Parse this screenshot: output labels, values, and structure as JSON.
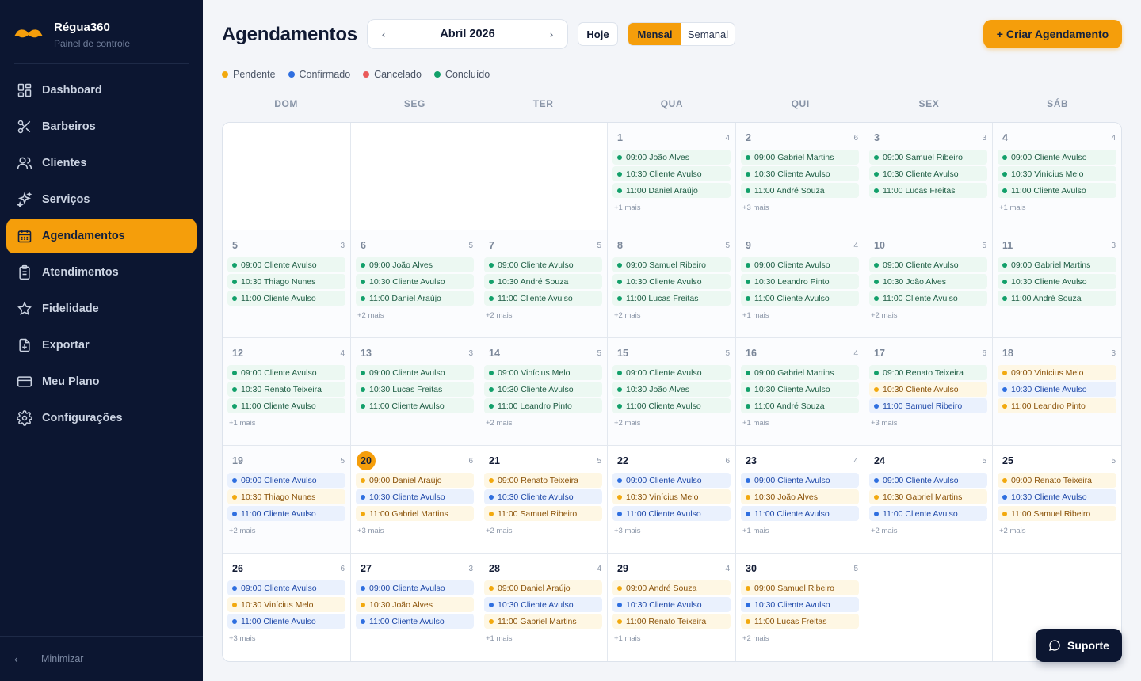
{
  "brand": {
    "name": "Régua360",
    "subtitle": "Painel de controle"
  },
  "nav": [
    {
      "label": "Dashboard",
      "icon": "dashboard-icon",
      "active": false
    },
    {
      "label": "Barbeiros",
      "icon": "scissors-icon",
      "active": false
    },
    {
      "label": "Clientes",
      "icon": "users-icon",
      "active": false
    },
    {
      "label": "Serviços",
      "icon": "sparkles-icon",
      "active": false
    },
    {
      "label": "Agendamentos",
      "icon": "calendar-icon",
      "active": true
    },
    {
      "label": "Atendimentos",
      "icon": "clipboard-icon",
      "active": false
    },
    {
      "label": "Fidelidade",
      "icon": "star-icon",
      "active": false
    },
    {
      "label": "Exportar",
      "icon": "file-download-icon",
      "active": false
    },
    {
      "label": "Meu Plano",
      "icon": "credit-card-icon",
      "active": false
    },
    {
      "label": "Configurações",
      "icon": "gear-icon",
      "active": false
    }
  ],
  "sidebar_footer": {
    "label": "Minimizar"
  },
  "header": {
    "title": "Agendamentos",
    "month_label": "Abril 2026",
    "prev": "‹",
    "next": "›",
    "today_label": "Hoje",
    "view_options": [
      {
        "label": "Mensal",
        "active": true
      },
      {
        "label": "Semanal",
        "active": false
      }
    ],
    "create_label": "+ Criar Agendamento"
  },
  "legend": [
    {
      "label": "Pendente",
      "color": "#f2a90e"
    },
    {
      "label": "Confirmado",
      "color": "#2f6fe0"
    },
    {
      "label": "Cancelado",
      "color": "#ea5a5a"
    },
    {
      "label": "Concluído",
      "color": "#12a06a"
    }
  ],
  "weekdays": [
    "DOM",
    "SEG",
    "TER",
    "QUA",
    "QUI",
    "SEX",
    "SÁB"
  ],
  "calendar": {
    "leading_empty": 3,
    "trailing_empty": 2,
    "today": 20,
    "days": [
      {
        "day": "1",
        "count": "4",
        "events": [
          [
            "09:00 João Alves",
            "done"
          ],
          [
            "10:30 Cliente Avulso",
            "done"
          ],
          [
            "11:00 Daniel Araújo",
            "done"
          ]
        ],
        "more": "+1 mais"
      },
      {
        "day": "2",
        "count": "6",
        "events": [
          [
            "09:00 Gabriel Martins",
            "done"
          ],
          [
            "10:30 Cliente Avulso",
            "done"
          ],
          [
            "11:00 André Souza",
            "done"
          ]
        ],
        "more": "+3 mais"
      },
      {
        "day": "3",
        "count": "3",
        "events": [
          [
            "09:00 Samuel Ribeiro",
            "done"
          ],
          [
            "10:30 Cliente Avulso",
            "done"
          ],
          [
            "11:00 Lucas Freitas",
            "done"
          ]
        ],
        "more": ""
      },
      {
        "day": "4",
        "count": "4",
        "events": [
          [
            "09:00 Cliente Avulso",
            "done"
          ],
          [
            "10:30 Vinícius Melo",
            "done"
          ],
          [
            "11:00 Cliente Avulso",
            "done"
          ]
        ],
        "more": "+1 mais"
      },
      {
        "day": "5",
        "count": "3",
        "events": [
          [
            "09:00 Cliente Avulso",
            "done"
          ],
          [
            "10:30 Thiago Nunes",
            "done"
          ],
          [
            "11:00 Cliente Avulso",
            "done"
          ]
        ],
        "more": ""
      },
      {
        "day": "6",
        "count": "5",
        "events": [
          [
            "09:00 João Alves",
            "done"
          ],
          [
            "10:30 Cliente Avulso",
            "done"
          ],
          [
            "11:00 Daniel Araújo",
            "done"
          ]
        ],
        "more": "+2 mais"
      },
      {
        "day": "7",
        "count": "5",
        "events": [
          [
            "09:00 Cliente Avulso",
            "done"
          ],
          [
            "10:30 André Souza",
            "done"
          ],
          [
            "11:00 Cliente Avulso",
            "done"
          ]
        ],
        "more": "+2 mais"
      },
      {
        "day": "8",
        "count": "5",
        "events": [
          [
            "09:00 Samuel Ribeiro",
            "done"
          ],
          [
            "10:30 Cliente Avulso",
            "done"
          ],
          [
            "11:00 Lucas Freitas",
            "done"
          ]
        ],
        "more": "+2 mais"
      },
      {
        "day": "9",
        "count": "4",
        "events": [
          [
            "09:00 Cliente Avulso",
            "done"
          ],
          [
            "10:30 Leandro Pinto",
            "done"
          ],
          [
            "11:00 Cliente Avulso",
            "done"
          ]
        ],
        "more": "+1 mais"
      },
      {
        "day": "10",
        "count": "5",
        "events": [
          [
            "09:00 Cliente Avulso",
            "done"
          ],
          [
            "10:30 João Alves",
            "done"
          ],
          [
            "11:00 Cliente Avulso",
            "done"
          ]
        ],
        "more": "+2 mais"
      },
      {
        "day": "11",
        "count": "3",
        "events": [
          [
            "09:00 Gabriel Martins",
            "done"
          ],
          [
            "10:30 Cliente Avulso",
            "done"
          ],
          [
            "11:00 André Souza",
            "done"
          ]
        ],
        "more": ""
      },
      {
        "day": "12",
        "count": "4",
        "events": [
          [
            "09:00 Cliente Avulso",
            "done"
          ],
          [
            "10:30 Renato Teixeira",
            "done"
          ],
          [
            "11:00 Cliente Avulso",
            "done"
          ]
        ],
        "more": "+1 mais"
      },
      {
        "day": "13",
        "count": "3",
        "events": [
          [
            "09:00 Cliente Avulso",
            "done"
          ],
          [
            "10:30 Lucas Freitas",
            "done"
          ],
          [
            "11:00 Cliente Avulso",
            "done"
          ]
        ],
        "more": ""
      },
      {
        "day": "14",
        "count": "5",
        "events": [
          [
            "09:00 Vinícius Melo",
            "done"
          ],
          [
            "10:30 Cliente Avulso",
            "done"
          ],
          [
            "11:00 Leandro Pinto",
            "done"
          ]
        ],
        "more": "+2 mais"
      },
      {
        "day": "15",
        "count": "5",
        "events": [
          [
            "09:00 Cliente Avulso",
            "done"
          ],
          [
            "10:30 João Alves",
            "done"
          ],
          [
            "11:00 Cliente Avulso",
            "done"
          ]
        ],
        "more": "+2 mais"
      },
      {
        "day": "16",
        "count": "4",
        "events": [
          [
            "09:00 Gabriel Martins",
            "done"
          ],
          [
            "10:30 Cliente Avulso",
            "done"
          ],
          [
            "11:00 André Souza",
            "done"
          ]
        ],
        "more": "+1 mais"
      },
      {
        "day": "17",
        "count": "6",
        "events": [
          [
            "09:00 Renato Teixeira",
            "done"
          ],
          [
            "10:30 Cliente Avulso",
            "pend"
          ],
          [
            "11:00 Samuel Ribeiro",
            "conf"
          ]
        ],
        "more": "+3 mais"
      },
      {
        "day": "18",
        "count": "3",
        "events": [
          [
            "09:00 Vinícius Melo",
            "pend"
          ],
          [
            "10:30 Cliente Avulso",
            "conf"
          ],
          [
            "11:00 Leandro Pinto",
            "pend"
          ]
        ],
        "more": ""
      },
      {
        "day": "19",
        "count": "5",
        "events": [
          [
            "09:00 Cliente Avulso",
            "conf"
          ],
          [
            "10:30 Thiago Nunes",
            "pend"
          ],
          [
            "11:00 Cliente Avulso",
            "conf"
          ]
        ],
        "more": "+2 mais"
      },
      {
        "day": "20",
        "count": "6",
        "events": [
          [
            "09:00 Daniel Araújo",
            "pend"
          ],
          [
            "10:30 Cliente Avulso",
            "conf"
          ],
          [
            "11:00 Gabriel Martins",
            "pend"
          ]
        ],
        "more": "+3 mais"
      },
      {
        "day": "21",
        "count": "5",
        "events": [
          [
            "09:00 Renato Teixeira",
            "pend"
          ],
          [
            "10:30 Cliente Avulso",
            "conf"
          ],
          [
            "11:00 Samuel Ribeiro",
            "pend"
          ]
        ],
        "more": "+2 mais"
      },
      {
        "day": "22",
        "count": "6",
        "events": [
          [
            "09:00 Cliente Avulso",
            "conf"
          ],
          [
            "10:30 Vinícius Melo",
            "pend"
          ],
          [
            "11:00 Cliente Avulso",
            "conf"
          ]
        ],
        "more": "+3 mais"
      },
      {
        "day": "23",
        "count": "4",
        "events": [
          [
            "09:00 Cliente Avulso",
            "conf"
          ],
          [
            "10:30 João Alves",
            "pend"
          ],
          [
            "11:00 Cliente Avulso",
            "conf"
          ]
        ],
        "more": "+1 mais"
      },
      {
        "day": "24",
        "count": "5",
        "events": [
          [
            "09:00 Cliente Avulso",
            "conf"
          ],
          [
            "10:30 Gabriel Martins",
            "pend"
          ],
          [
            "11:00 Cliente Avulso",
            "conf"
          ]
        ],
        "more": "+2 mais"
      },
      {
        "day": "25",
        "count": "5",
        "events": [
          [
            "09:00 Renato Teixeira",
            "pend"
          ],
          [
            "10:30 Cliente Avulso",
            "conf"
          ],
          [
            "11:00 Samuel Ribeiro",
            "pend"
          ]
        ],
        "more": "+2 mais"
      },
      {
        "day": "26",
        "count": "6",
        "events": [
          [
            "09:00 Cliente Avulso",
            "conf"
          ],
          [
            "10:30 Vinícius Melo",
            "pend"
          ],
          [
            "11:00 Cliente Avulso",
            "conf"
          ]
        ],
        "more": "+3 mais"
      },
      {
        "day": "27",
        "count": "3",
        "events": [
          [
            "09:00 Cliente Avulso",
            "conf"
          ],
          [
            "10:30 João Alves",
            "pend"
          ],
          [
            "11:00 Cliente Avulso",
            "conf"
          ]
        ],
        "more": ""
      },
      {
        "day": "28",
        "count": "4",
        "events": [
          [
            "09:00 Daniel Araújo",
            "pend"
          ],
          [
            "10:30 Cliente Avulso",
            "conf"
          ],
          [
            "11:00 Gabriel Martins",
            "pend"
          ]
        ],
        "more": "+1 mais"
      },
      {
        "day": "29",
        "count": "4",
        "events": [
          [
            "09:00 André Souza",
            "pend"
          ],
          [
            "10:30 Cliente Avulso",
            "conf"
          ],
          [
            "11:00 Renato Teixeira",
            "pend"
          ]
        ],
        "more": "+1 mais"
      },
      {
        "day": "30",
        "count": "5",
        "events": [
          [
            "09:00 Samuel Ribeiro",
            "pend"
          ],
          [
            "10:30 Cliente Avulso",
            "conf"
          ],
          [
            "11:00 Lucas Freitas",
            "pend"
          ]
        ],
        "more": "+2 mais"
      }
    ]
  },
  "support": {
    "label": "Suporte"
  }
}
